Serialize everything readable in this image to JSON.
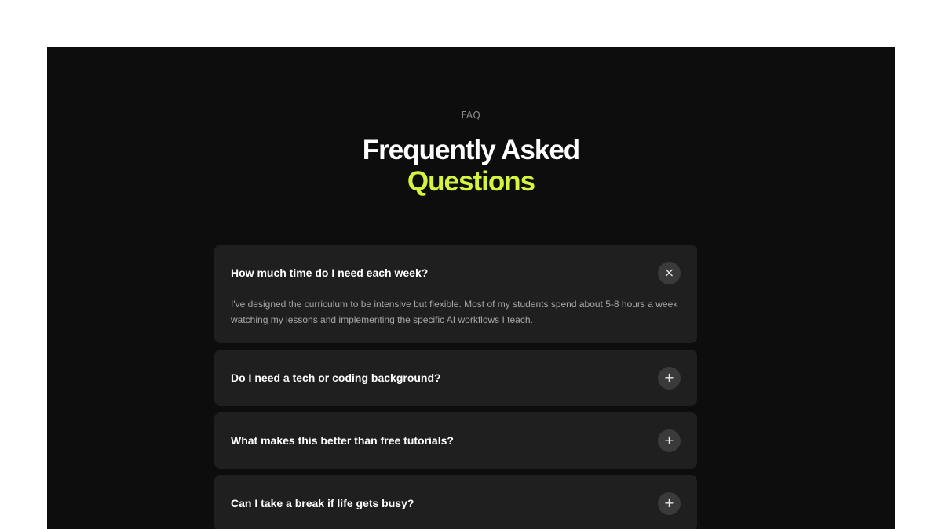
{
  "header": {
    "eyebrow": "FAQ",
    "title_line1": "Frequently Asked",
    "title_line2": "Questions"
  },
  "colors": {
    "background": "#0d0d0d",
    "card": "#1f1f1f",
    "accent": "#d4f53c",
    "toggle": "#3a3a3a"
  },
  "faq": {
    "items": [
      {
        "question": "How much time do I need each week?",
        "answer": "I've designed the curriculum to be intensive but flexible. Most of my students spend about 5-8 hours a week watching my lessons and implementing the specific AI workflows I teach.",
        "toggle_icon": "×",
        "expanded": true
      },
      {
        "question": "Do I need a tech or coding background?",
        "toggle_icon": "+",
        "expanded": false
      },
      {
        "question": "What makes this better than free tutorials?",
        "toggle_icon": "+",
        "expanded": false
      },
      {
        "question": "Can I take a break if life gets busy?",
        "toggle_icon": "+",
        "expanded": false
      }
    ]
  }
}
